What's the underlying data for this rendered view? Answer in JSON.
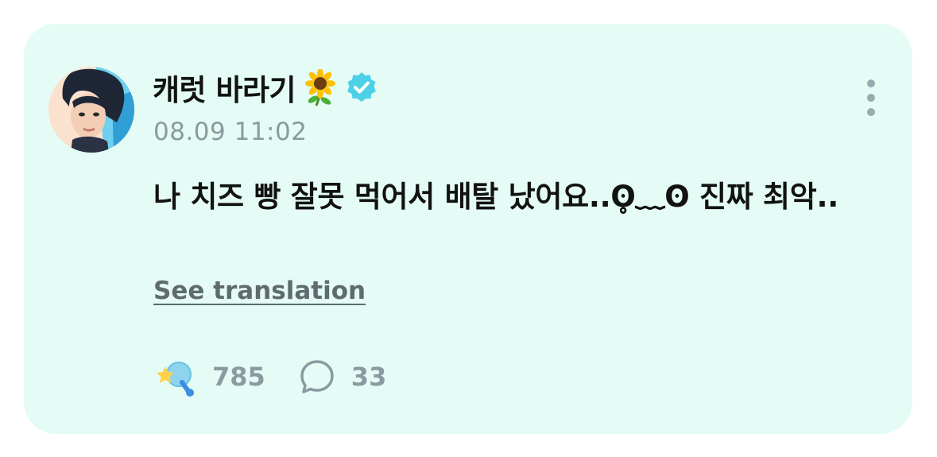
{
  "post": {
    "author_name": "캐럿 바라기",
    "author_emoji": "sunflower-icon",
    "verified": true,
    "timestamp": "08.09 11:02",
    "text": "나 치즈 빵 잘못 먹어서 배탈 났어요..ʘ̥﹏ʘ 진짜 최악..",
    "see_translation_label": "See translation",
    "like_count": "785",
    "comment_count": "33"
  },
  "colors": {
    "card_background": "#e4fcf5",
    "verified_badge": "#4dd0e8",
    "muted_text": "#8a9aa0"
  }
}
